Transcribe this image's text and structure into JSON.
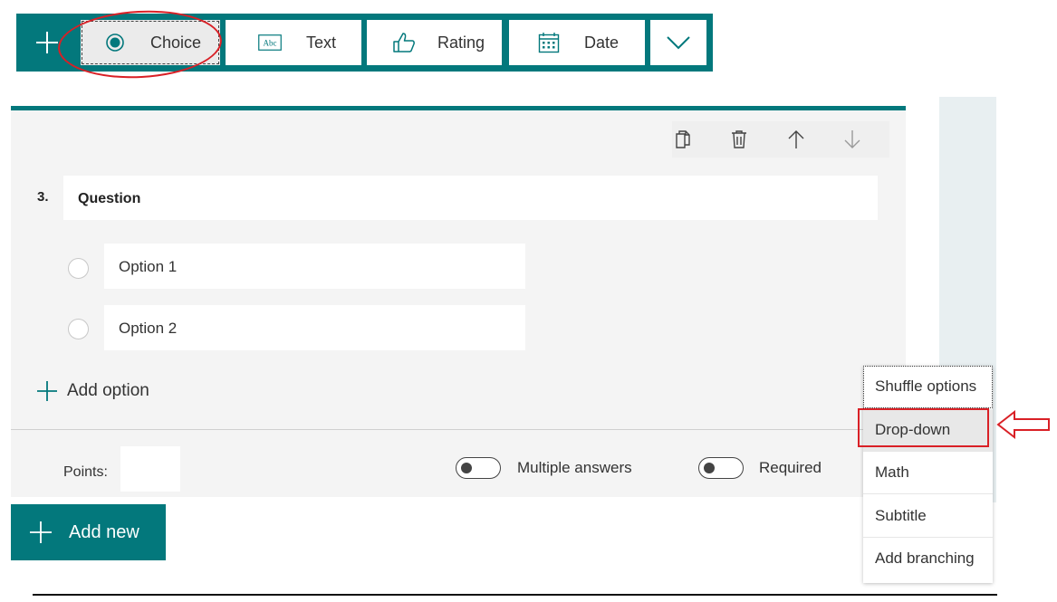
{
  "toolbar": {
    "add_label": "+",
    "types": [
      {
        "label": "Choice",
        "icon": "radio-filled-icon",
        "selected": true
      },
      {
        "label": "Text",
        "icon": "abc-text-icon"
      },
      {
        "label": "Rating",
        "icon": "thumbs-up-icon"
      },
      {
        "label": "Date",
        "icon": "calendar-icon"
      }
    ],
    "more_icon": "chevron-down-icon",
    "abc_glyph": "Abc"
  },
  "question": {
    "number": "3.",
    "title": "Question",
    "options": [
      "Option 1",
      "Option 2"
    ],
    "add_option_label": "Add option",
    "actions": [
      "copy-icon",
      "delete-icon",
      "move-up-icon",
      "move-down-icon"
    ]
  },
  "footer": {
    "points_label": "Points:",
    "points_value": "",
    "multiple_answers_label": "Multiple answers",
    "multiple_answers_on": false,
    "required_label": "Required",
    "required_on": false
  },
  "add_new_label": "Add new",
  "menu": {
    "items": [
      "Shuffle options",
      "Drop-down",
      "Math",
      "Subtitle",
      "Add branching"
    ],
    "highlighted": "Drop-down"
  },
  "colors": {
    "accent": "#03787c",
    "annotation": "#d92026",
    "card_bg": "#f4f4f4"
  }
}
